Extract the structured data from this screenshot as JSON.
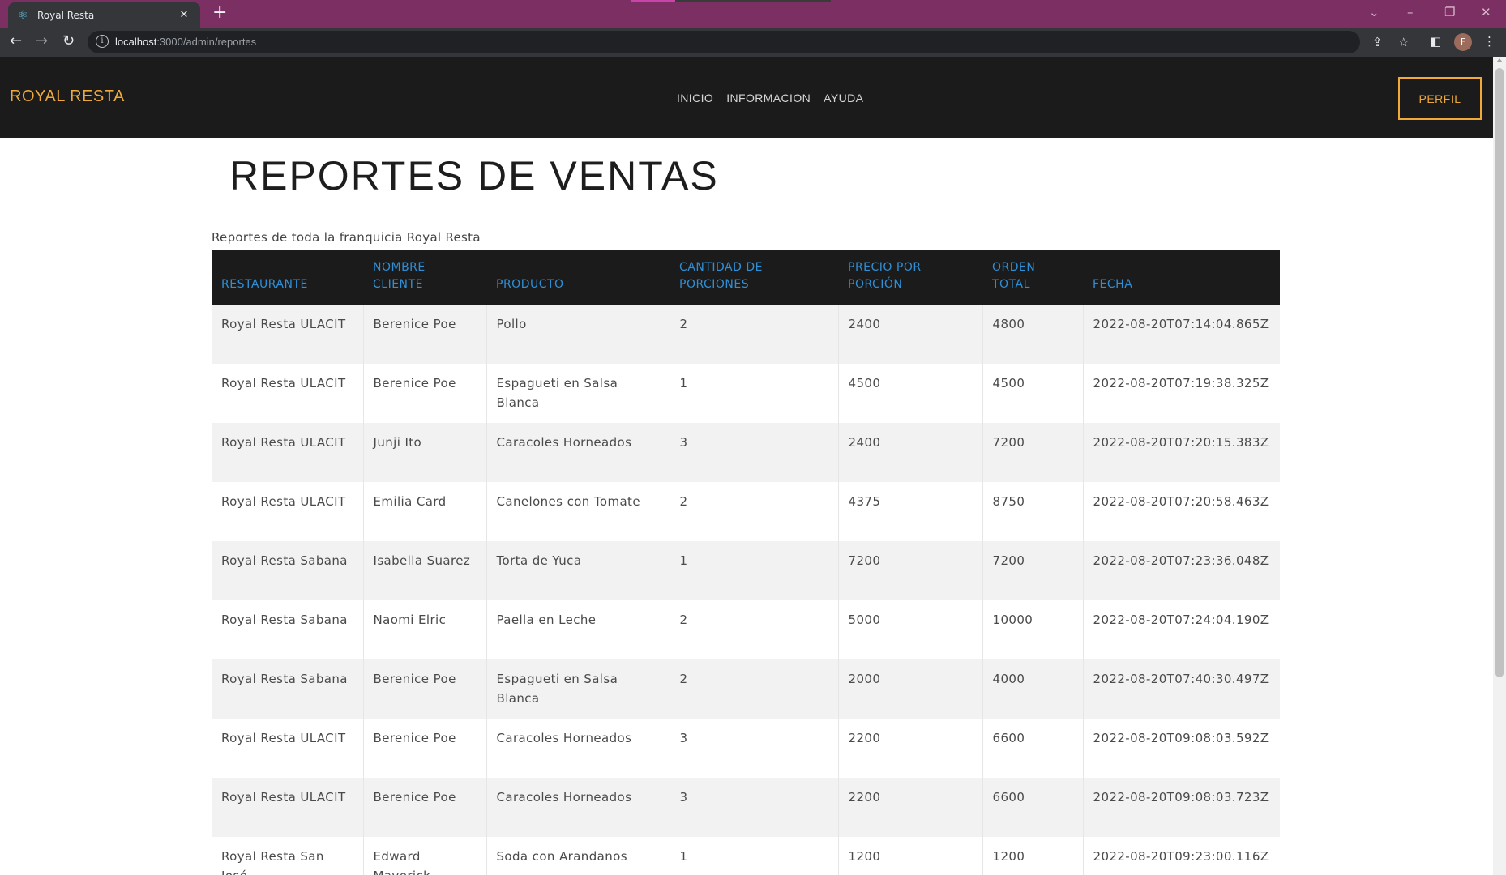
{
  "browser": {
    "tab_title": "Royal Resta",
    "url_host": "localhost",
    "url_path": ":3000/admin/reportes",
    "avatar_initial": "F"
  },
  "nav": {
    "brand": "ROYAL RESTA",
    "menu": [
      "INICIO",
      "INFORMACION",
      "AYUDA"
    ],
    "profile_button": "PERFIL"
  },
  "page": {
    "title": "REPORTES DE VENTAS",
    "subtitle": "Reportes de toda la franquicia Royal Resta"
  },
  "table": {
    "headers": [
      "RESTAURANTE",
      "NOMBRE CLIENTE",
      "PRODUCTO",
      "CANTIDAD DE PORCIONES",
      "PRECIO POR PORCIÓN",
      "ORDEN TOTAL",
      "FECHA"
    ],
    "rows": [
      [
        "Royal Resta ULACIT",
        "Berenice Poe",
        "Pollo",
        "2",
        "2400",
        "4800",
        "2022-08-20T07:14:04.865Z"
      ],
      [
        "Royal Resta ULACIT",
        "Berenice Poe",
        "Espagueti en Salsa Blanca",
        "1",
        "4500",
        "4500",
        "2022-08-20T07:19:38.325Z"
      ],
      [
        "Royal Resta ULACIT",
        "Junji Ito",
        "Caracoles Horneados",
        "3",
        "2400",
        "7200",
        "2022-08-20T07:20:15.383Z"
      ],
      [
        "Royal Resta ULACIT",
        "Emilia Card",
        "Canelones con Tomate",
        "2",
        "4375",
        "8750",
        "2022-08-20T07:20:58.463Z"
      ],
      [
        "Royal Resta Sabana",
        "Isabella Suarez",
        "Torta de Yuca",
        "1",
        "7200",
        "7200",
        "2022-08-20T07:23:36.048Z"
      ],
      [
        "Royal Resta Sabana",
        "Naomi Elric",
        "Paella en Leche",
        "2",
        "5000",
        "10000",
        "2022-08-20T07:24:04.190Z"
      ],
      [
        "Royal Resta Sabana",
        "Berenice Poe",
        "Espagueti en Salsa Blanca",
        "2",
        "2000",
        "4000",
        "2022-08-20T07:40:30.497Z"
      ],
      [
        "Royal Resta ULACIT",
        "Berenice Poe",
        "Caracoles Horneados",
        "3",
        "2200",
        "6600",
        "2022-08-20T09:08:03.592Z"
      ],
      [
        "Royal Resta ULACIT",
        "Berenice Poe",
        "Caracoles Horneados",
        "3",
        "2200",
        "6600",
        "2022-08-20T09:08:03.723Z"
      ],
      [
        "Royal Resta San José",
        "Edward Maverick",
        "Soda con Arandanos",
        "1",
        "1200",
        "1200",
        "2022-08-20T09:23:00.116Z"
      ]
    ]
  },
  "colors": {
    "tabstrip": "#7b2f62",
    "nav_background": "#1b1b1b",
    "brand_accent": "#f0a93b",
    "header_text": "#2f8fd6"
  }
}
